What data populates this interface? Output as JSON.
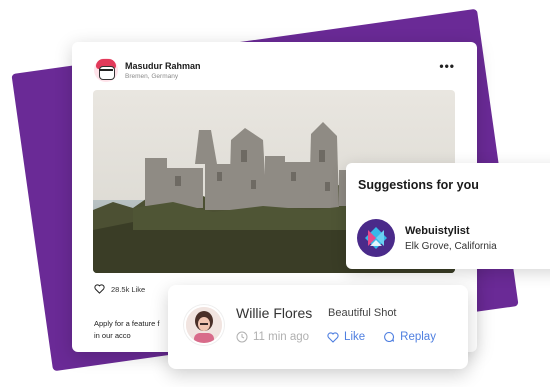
{
  "post": {
    "author_name": "Masudur Rahman",
    "author_location": "Bremen, Germany",
    "more_icon": "more-horizontal-icon",
    "likes_count": "28.5k Like",
    "caption_line1": "Apply for a feature f",
    "caption_line2": "in our acco"
  },
  "suggestions": {
    "title": "Suggestions for you",
    "brand_name": "Webuistylist",
    "brand_location": "Elk Grove, California"
  },
  "comment": {
    "name": "Willie Flores",
    "text": "Beautiful Shot",
    "time": "11 min ago",
    "like_label": "Like",
    "reply_label": "Replay"
  },
  "colors": {
    "accent_purple": "#6a2a96",
    "link_blue": "#4f7fe0"
  }
}
